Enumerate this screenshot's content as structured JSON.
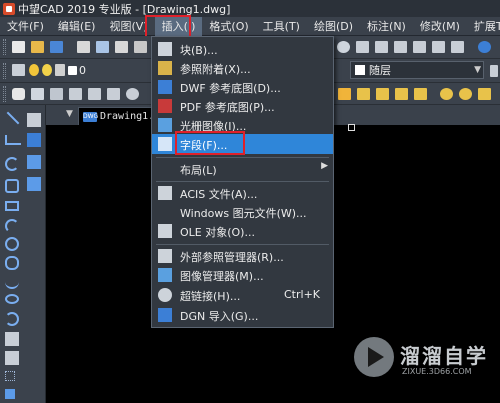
{
  "window": {
    "title": "中望CAD 2019 专业版 - [Drawing1.dwg]"
  },
  "menubar": [
    {
      "label": "文件(F)"
    },
    {
      "label": "编辑(E)"
    },
    {
      "label": "视图(V)"
    },
    {
      "label": "插入(I)",
      "active": true
    },
    {
      "label": "格式(O)"
    },
    {
      "label": "工具(T)"
    },
    {
      "label": "绘图(D)"
    },
    {
      "label": "标注(N)"
    },
    {
      "label": "修改(M)"
    },
    {
      "label": "扩展T"
    }
  ],
  "toolbar": {
    "current_layer": "0",
    "layer_combo_value": "随层"
  },
  "document_tab": {
    "label": "Drawing1.dwg"
  },
  "insert_menu": {
    "items": [
      {
        "label": "块(B)...",
        "icon": "block-icon"
      },
      {
        "label": "参照附着(X)...",
        "icon": "xref-attach-icon"
      },
      {
        "label": "DWF 参考底图(D)...",
        "icon": "dwf-icon"
      },
      {
        "label": "PDF 参考底图(P)...",
        "icon": "pdf-icon"
      },
      {
        "label": "光栅图像(I)...",
        "icon": "raster-image-icon"
      },
      {
        "label": "字段(F)...",
        "icon": "field-icon",
        "highlighted": true
      },
      {
        "label": "布局(L)",
        "icon": "",
        "submenu": true
      },
      {
        "label": "ACIS 文件(A)...",
        "icon": "acis-icon"
      },
      {
        "label": "Windows 图元文件(W)...",
        "icon": ""
      },
      {
        "label": "OLE 对象(O)...",
        "icon": "ole-icon"
      },
      {
        "label": "外部参照管理器(R)...",
        "icon": "xref-manager-icon"
      },
      {
        "label": "图像管理器(M)...",
        "icon": "image-manager-icon"
      },
      {
        "label": "超链接(H)...",
        "icon": "hyperlink-icon",
        "shortcut": "Ctrl+K"
      },
      {
        "label": "DGN 导入(G)...",
        "icon": "dgn-icon"
      }
    ]
  },
  "watermark": {
    "name": "溜溜自学",
    "url": "ZIXUE.3D66.COM"
  }
}
